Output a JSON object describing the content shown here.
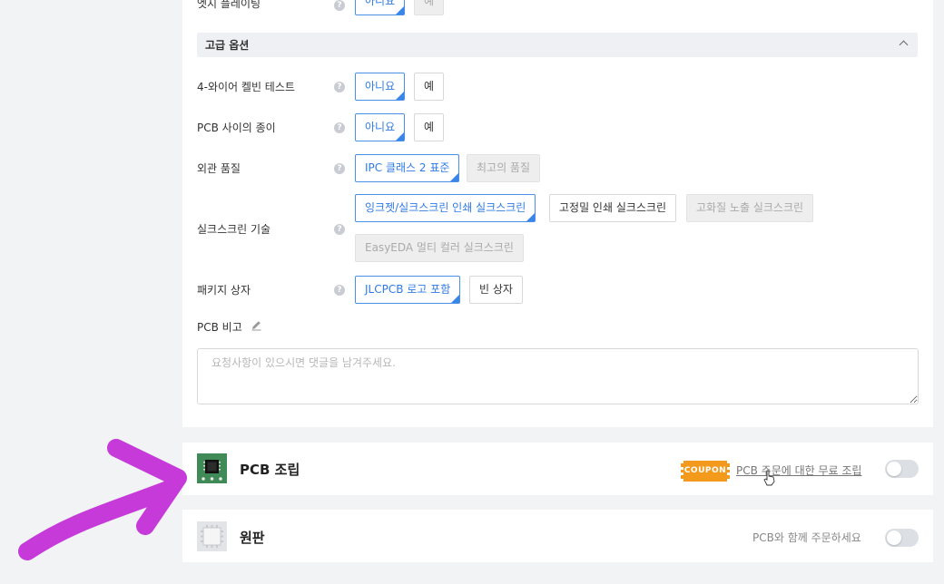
{
  "colors": {
    "accent": "#2f7be5",
    "page_bg": "#f2f3f5",
    "coupon": "#f39a1d",
    "arrow": "#c53ad8"
  },
  "edge_plating": {
    "label": "엣지 플레이팅",
    "options": [
      "아니요",
      "예"
    ],
    "selected": "아니요"
  },
  "advanced": {
    "title": "고급 옵션"
  },
  "kelvin_test": {
    "label": "4-와이어 켈빈 테스트",
    "options": [
      "아니요",
      "예"
    ],
    "selected": "아니요"
  },
  "paper_between": {
    "label": "PCB 사이의 종이",
    "options": [
      "아니요",
      "예"
    ],
    "selected": "아니요"
  },
  "appearance": {
    "label": "외관 품질",
    "options": [
      "IPC 클래스 2 표준",
      "최고의 품질"
    ],
    "selected": "IPC 클래스 2 표준"
  },
  "silkscreen": {
    "label": "실크스크린 기술",
    "options": [
      "잉크젯/실크스크린 인쇄 실크스크린",
      "고정밀 인쇄 실크스크린",
      "고화질 노출 실크스크린",
      "EasyEDA 멀티 컬러 실크스크린"
    ],
    "selected": "잉크젯/실크스크린 인쇄 실크스크린"
  },
  "package": {
    "label": "패키지 상자",
    "options": [
      "JLCPCB 로고 포함",
      "빈 상자"
    ],
    "selected": "JLCPCB 로고 포함"
  },
  "remark": {
    "label": "PCB 비고",
    "placeholder": "요청사항이 있으시면 댓글을 남겨주세요."
  },
  "assembly": {
    "title": "PCB 조립",
    "coupon_text": "COUPON",
    "link": "PCB 주문에 대한 무료 조립",
    "toggle_on": false
  },
  "stencil": {
    "title": "원판",
    "note": "PCB와 함께 주문하세요",
    "toggle_on": false
  }
}
